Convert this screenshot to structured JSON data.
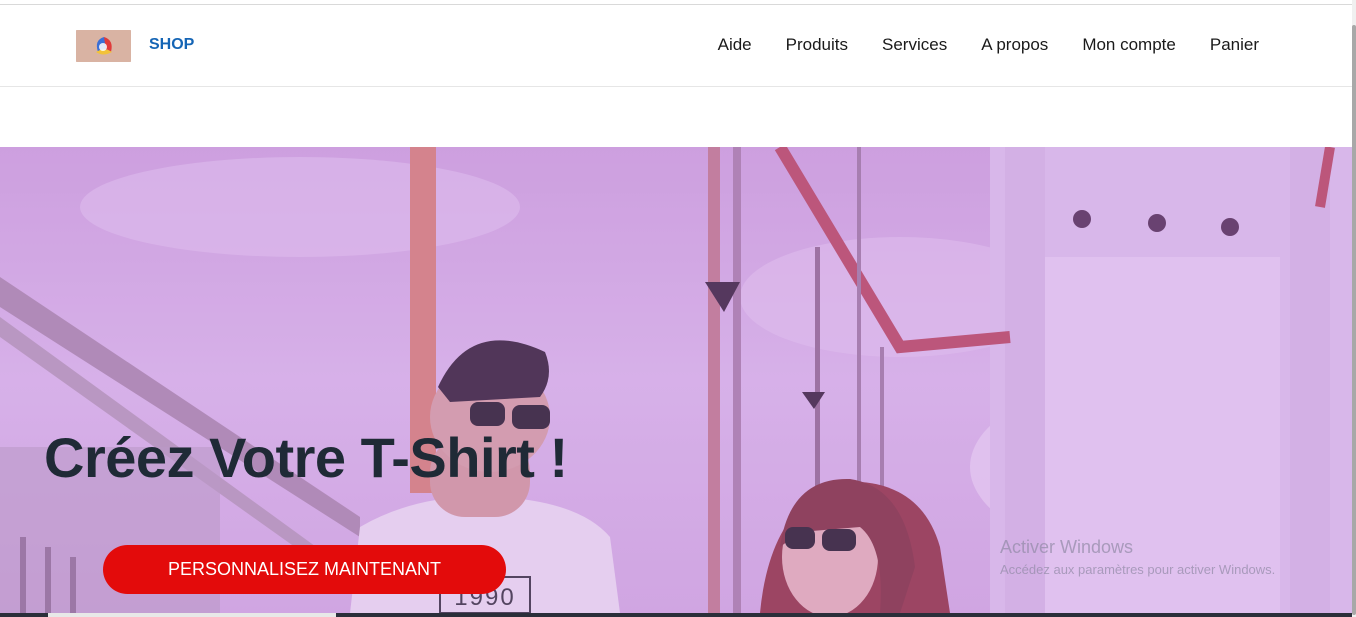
{
  "header": {
    "brand": "SHOP",
    "logo_icon": "shop-logo-icon",
    "nav": [
      {
        "label": "Aide"
      },
      {
        "label": "Produits"
      },
      {
        "label": "Services"
      },
      {
        "label": "A propos"
      },
      {
        "label": "Mon compte"
      },
      {
        "label": "Panier"
      }
    ]
  },
  "hero": {
    "title": "Créez Votre T-Shirt !",
    "cta_label": "PERSONNALISEZ MAINTENANT",
    "shirt_print": "1990"
  },
  "watermark": {
    "title": "Activer Windows",
    "subtitle": "Accédez aux paramètres pour activer Windows."
  },
  "colors": {
    "brand": "#1565b5",
    "cta": "#e30b0b",
    "hero_tint": "#d6b0e6",
    "title": "#1f2a36"
  }
}
